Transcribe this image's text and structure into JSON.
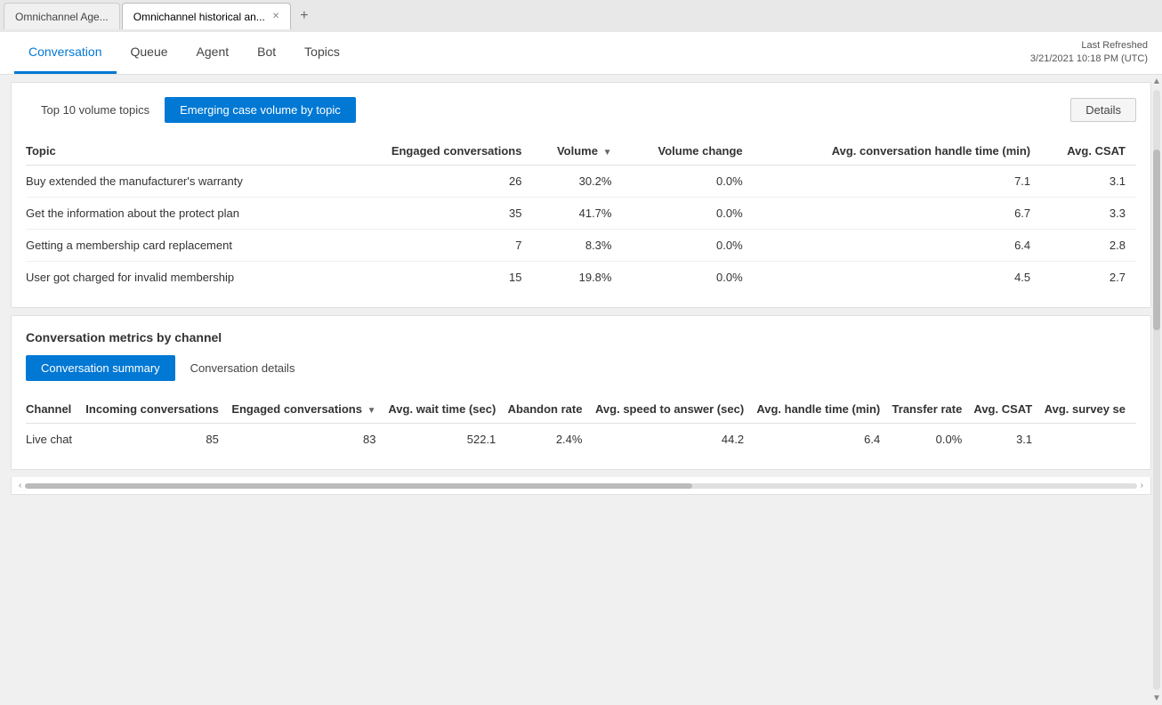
{
  "browser": {
    "tabs": [
      {
        "id": "tab1",
        "label": "Omnichannel Age...",
        "active": false
      },
      {
        "id": "tab2",
        "label": "Omnichannel historical an...",
        "active": true
      }
    ],
    "new_tab_label": "+"
  },
  "nav": {
    "tabs": [
      {
        "id": "conversation",
        "label": "Conversation",
        "active": true
      },
      {
        "id": "queue",
        "label": "Queue",
        "active": false
      },
      {
        "id": "agent",
        "label": "Agent",
        "active": false
      },
      {
        "id": "bot",
        "label": "Bot",
        "active": false
      },
      {
        "id": "topics",
        "label": "Topics",
        "active": false
      }
    ],
    "last_refreshed_label": "Last Refreshed",
    "last_refreshed_value": "3/21/2021 10:18 PM (UTC)"
  },
  "topics_section": {
    "tab_top10": "Top 10 volume topics",
    "tab_emerging": "Emerging case volume by topic",
    "details_btn": "Details",
    "columns": [
      {
        "id": "topic",
        "label": "Topic",
        "numeric": false
      },
      {
        "id": "engaged",
        "label": "Engaged conversations",
        "numeric": true
      },
      {
        "id": "volume",
        "label": "Volume",
        "numeric": true,
        "sortable": true
      },
      {
        "id": "volume_change",
        "label": "Volume change",
        "numeric": true
      },
      {
        "id": "avg_handle",
        "label": "Avg. conversation handle time (min)",
        "numeric": true
      },
      {
        "id": "avg_csat",
        "label": "Avg. CSAT",
        "numeric": true
      }
    ],
    "rows": [
      {
        "topic": "Buy extended the manufacturer's warranty",
        "engaged": "26",
        "volume": "30.2%",
        "volume_change": "0.0%",
        "avg_handle": "7.1",
        "avg_csat": "3.1"
      },
      {
        "topic": "Get the information about the protect plan",
        "engaged": "35",
        "volume": "41.7%",
        "volume_change": "0.0%",
        "avg_handle": "6.7",
        "avg_csat": "3.3"
      },
      {
        "topic": "Getting a membership card replacement",
        "engaged": "7",
        "volume": "8.3%",
        "volume_change": "0.0%",
        "avg_handle": "6.4",
        "avg_csat": "2.8"
      },
      {
        "topic": "User got charged for invalid membership",
        "engaged": "15",
        "volume": "19.8%",
        "volume_change": "0.0%",
        "avg_handle": "4.5",
        "avg_csat": "2.7"
      }
    ]
  },
  "metrics_section": {
    "title": "Conversation metrics by channel",
    "subtab_summary": "Conversation summary",
    "subtab_details": "Conversation details",
    "columns": [
      {
        "id": "channel",
        "label": "Channel",
        "numeric": false
      },
      {
        "id": "incoming",
        "label": "Incoming conversations",
        "numeric": true
      },
      {
        "id": "engaged",
        "label": "Engaged conversations",
        "numeric": true,
        "sortable": true
      },
      {
        "id": "avg_wait",
        "label": "Avg. wait time (sec)",
        "numeric": true
      },
      {
        "id": "abandon",
        "label": "Abandon rate",
        "numeric": true
      },
      {
        "id": "avg_speed",
        "label": "Avg. speed to answer (sec)",
        "numeric": true
      },
      {
        "id": "avg_handle",
        "label": "Avg. handle time (min)",
        "numeric": true
      },
      {
        "id": "transfer",
        "label": "Transfer rate",
        "numeric": true
      },
      {
        "id": "avg_csat",
        "label": "Avg. CSAT",
        "numeric": true
      },
      {
        "id": "avg_survey",
        "label": "Avg. survey se",
        "numeric": true
      }
    ],
    "rows": [
      {
        "channel": "Live chat",
        "incoming": "85",
        "engaged": "83",
        "avg_wait": "522.1",
        "abandon": "2.4%",
        "avg_speed": "44.2",
        "avg_handle": "6.4",
        "transfer": "0.0%",
        "avg_csat": "3.1",
        "avg_survey": ""
      }
    ]
  },
  "colors": {
    "accent": "#0078d4",
    "active_tab_border": "#0078d4",
    "table_border": "#e0e0e0"
  }
}
